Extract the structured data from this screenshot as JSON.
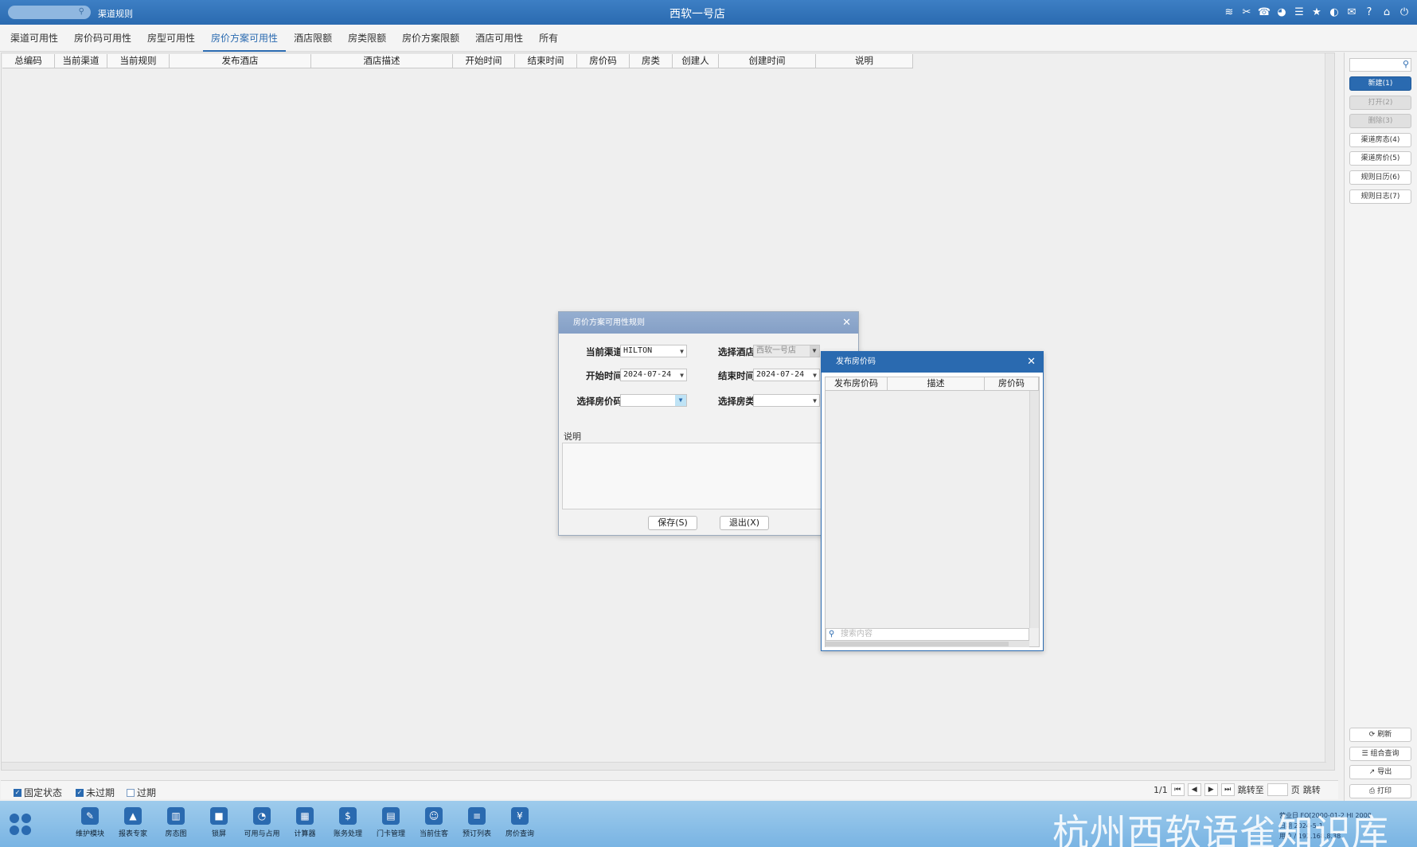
{
  "titlebar": {
    "breadcrumb": "渠道规则",
    "title": "西软一号店",
    "icons": [
      "wifi-icon",
      "tools-icon",
      "phone-icon",
      "palette-icon",
      "menu-icon",
      "star-icon",
      "moon-icon",
      "mail-icon",
      "help-icon",
      "home-icon",
      "power-icon"
    ]
  },
  "tabs": [
    "渠道可用性",
    "房价码可用性",
    "房型可用性",
    "房价方案可用性",
    "酒店限额",
    "房类限额",
    "房价方案限额",
    "酒店可用性",
    "所有"
  ],
  "active_tab": "房价方案可用性",
  "grid": {
    "columns": [
      "总编码",
      "当前渠道",
      "当前规则",
      "发布酒店",
      "酒店描述",
      "开始时间",
      "结束时间",
      "房价码",
      "房类",
      "创建人",
      "创建时间",
      "说明"
    ]
  },
  "right_panel": {
    "top_buttons": [
      {
        "label": "新建(1)",
        "state": "primary"
      },
      {
        "label": "打开(2)",
        "state": "disabled"
      },
      {
        "label": "删除(3)",
        "state": "disabled"
      },
      {
        "label": "渠道房态(4)",
        "state": "normal"
      },
      {
        "label": "渠道房价(5)",
        "state": "normal"
      },
      {
        "label": "规则日历(6)",
        "state": "normal"
      },
      {
        "label": "规则日志(7)",
        "state": "normal"
      }
    ],
    "bottom_buttons": [
      {
        "label": "刷新",
        "icon": "refresh-icon",
        "glyph": "⟳"
      },
      {
        "label": "组合查询",
        "icon": "list-icon",
        "glyph": "☰"
      },
      {
        "label": "导出",
        "icon": "export-icon",
        "glyph": "↗"
      },
      {
        "label": "打印",
        "icon": "print-icon",
        "glyph": "⎙"
      }
    ]
  },
  "filters": [
    {
      "label": "固定状态",
      "checked": true
    },
    {
      "label": "未过期",
      "checked": true
    },
    {
      "label": "过期",
      "checked": false
    }
  ],
  "pager": {
    "page_info": "1/1",
    "jump_to": "跳转至",
    "page_unit": "页",
    "jump": "跳转"
  },
  "dialog_rule": {
    "title": "房价方案可用性规则",
    "fields": {
      "channel_label": "当前渠道",
      "channel_value": "HILTON",
      "hotel_label": "选择酒店",
      "hotel_value": "西软一号店",
      "start_label": "开始时间",
      "start_value": "2024-07-24",
      "end_label": "结束时间",
      "end_value": "2024-07-24",
      "ratecode_label": "选择房价码",
      "ratecode_value": "",
      "roomtype_label": "选择房类",
      "roomtype_value": ""
    },
    "note_label": "说明",
    "save_label": "保存(S)",
    "exit_label": "退出(X)"
  },
  "dialog_picker": {
    "title": "发布房价码",
    "columns": [
      "发布房价码",
      "描述",
      "房价码"
    ],
    "search_placeholder": "搜索内容"
  },
  "dock": {
    "items": [
      {
        "label": "维护模块",
        "icon": "wrench-icon",
        "glyph": "✎"
      },
      {
        "label": "报表专家",
        "icon": "graduation-cap-icon",
        "glyph": "▲"
      },
      {
        "label": "房态图",
        "icon": "bank-icon",
        "glyph": "▥"
      },
      {
        "label": "锁屏",
        "icon": "lock-icon",
        "glyph": "■"
      },
      {
        "label": "可用与占用",
        "icon": "pie-chart-icon",
        "glyph": "◔"
      },
      {
        "label": "计算器",
        "icon": "calculator-icon",
        "glyph": "▦"
      },
      {
        "label": "账务处理",
        "icon": "account-icon",
        "glyph": "$"
      },
      {
        "label": "门卡管理",
        "icon": "card-icon",
        "glyph": "▤"
      },
      {
        "label": "当前住客",
        "icon": "guest-icon",
        "glyph": "☺"
      },
      {
        "label": "预订列表",
        "icon": "booking-list-icon",
        "glyph": "≡"
      },
      {
        "label": "房价查询",
        "icon": "rate-query-icon",
        "glyph": "¥"
      }
    ],
    "info_lines": [
      "营业日 FO[2000-01-2 HI 2000",
      "日期 2024-5-1",
      "用户 / 192.168.8.38"
    ],
    "watermark": "杭州西软语雀知识库"
  },
  "colors": {
    "brand": "#2a6ab0",
    "dialog_header": "#8aa4c9"
  }
}
